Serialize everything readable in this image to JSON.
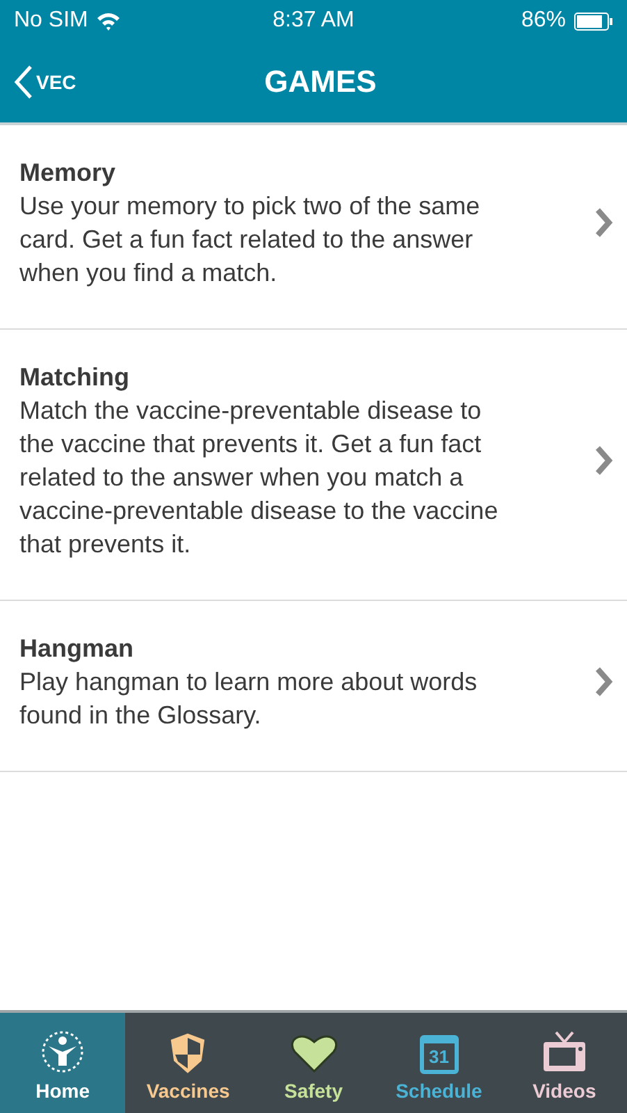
{
  "status_bar": {
    "carrier": "No SIM",
    "time": "8:37 AM",
    "battery": "86%"
  },
  "nav": {
    "back": "VEC",
    "title": "GAMES"
  },
  "games": [
    {
      "title": "Memory",
      "description": "Use your memory to pick two of the same card. Get a fun fact related to the answer when you find a match."
    },
    {
      "title": "Matching",
      "description": "Match the vaccine-preventable disease to the vaccine that prevents it. Get a fun fact related to the answer when you match a vaccine-preventable disease to the vaccine that prevents it."
    },
    {
      "title": "Hangman",
      "description": "Play hangman to learn more about words found in the Glossary."
    }
  ],
  "tabs": [
    {
      "kind": "home",
      "label": "Home",
      "selected": true,
      "color": "#ffffff"
    },
    {
      "kind": "shield",
      "label": "Vaccines",
      "selected": false,
      "color": "#f7c98f"
    },
    {
      "kind": "heart",
      "label": "Safety",
      "selected": false,
      "color": "#c6e29a"
    },
    {
      "kind": "calendar",
      "label": "Schedule",
      "selected": false,
      "color": "#4bb3d6",
      "icon_text": "31"
    },
    {
      "kind": "tv",
      "label": "Videos",
      "selected": false,
      "color": "#ecccd4"
    }
  ]
}
